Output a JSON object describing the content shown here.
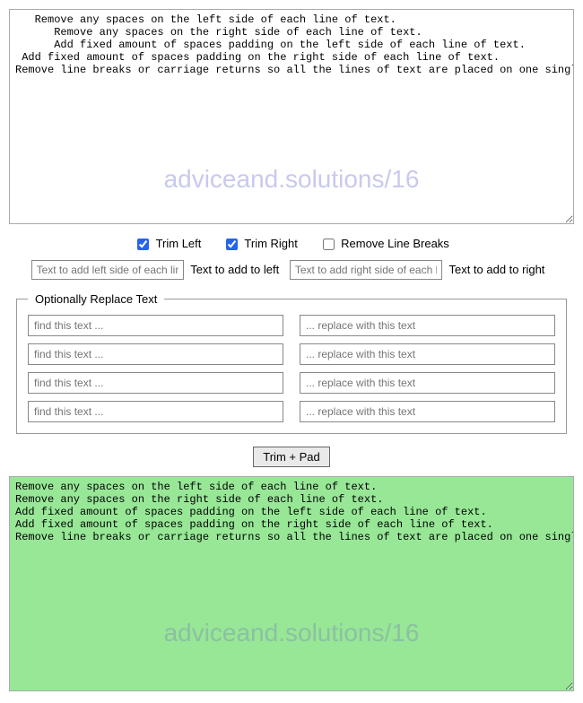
{
  "watermark": "adviceand.solutions/16",
  "input_text": "   Remove any spaces on the left side of each line of text.\n      Remove any spaces on the right side of each line of text.\n      Add fixed amount of spaces padding on the left side of each line of text.\n Add fixed amount of spaces padding on the right side of each line of text.\nRemove line breaks or carriage returns so all the lines of text are placed on one single line.",
  "checks": {
    "trim_left": {
      "label": "Trim Left",
      "checked": true
    },
    "trim_right": {
      "label": "Trim Right",
      "checked": true
    },
    "remove_breaks": {
      "label": "Remove Line Breaks",
      "checked": false
    }
  },
  "pad": {
    "left_placeholder": "Text to add left side of each line",
    "left_label": "Text to add to left",
    "right_placeholder": "Text to add right side of each line",
    "right_label": "Text to add to right"
  },
  "replace_legend": "Optionally Replace Text",
  "replace_rows": [
    {
      "find_ph": "find this text ...",
      "replace_ph": "... replace with this text"
    },
    {
      "find_ph": "find this text ...",
      "replace_ph": "... replace with this text"
    },
    {
      "find_ph": "find this text ...",
      "replace_ph": "... replace with this text"
    },
    {
      "find_ph": "find this text ...",
      "replace_ph": "... replace with this text"
    }
  ],
  "action_button": "Trim + Pad",
  "output_text": "Remove any spaces on the left side of each line of text.\nRemove any spaces on the right side of each line of text.\nAdd fixed amount of spaces padding on the left side of each line of text.\nAdd fixed amount of spaces padding on the right side of each line of text.\nRemove line breaks or carriage returns so all the lines of text are placed on one single line."
}
